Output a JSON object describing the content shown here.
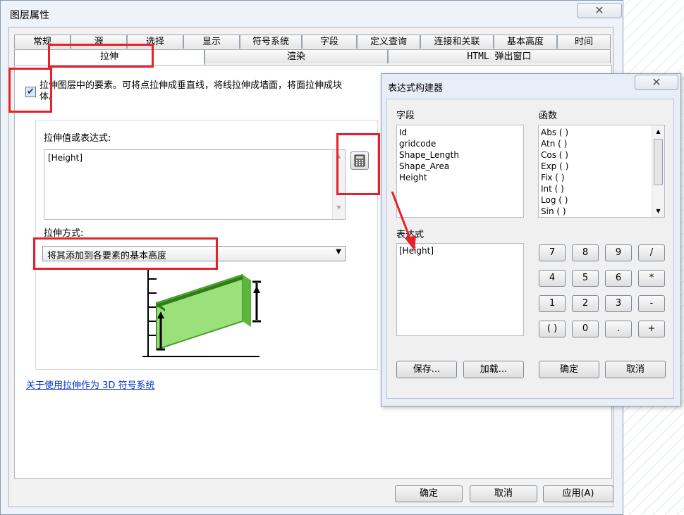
{
  "main": {
    "title": "图层属性",
    "close": "✕",
    "tabs_row1": [
      "常规",
      "源",
      "选择",
      "显示",
      "符号系统",
      "字段",
      "定义查询",
      "连接和关联",
      "基本高度",
      "时间"
    ],
    "tabs_row2": [
      "拉伸",
      "渲染",
      "HTML 弹出窗口"
    ],
    "active_tab": "拉伸",
    "extrude_checkbox_checked": true,
    "extrude_label": "拉伸图层中的要素。可将点拉伸成垂直线，将线拉伸成墙面，将面拉伸成块体。",
    "expr_label": "拉伸值或表达式:",
    "expr_value": "[Height]",
    "calc_icon": "calculator-icon",
    "method_label": "拉伸方式:",
    "method_value": "将其添加到各要素的基本高度",
    "link": "关于使用拉伸作为 3D 符号系统",
    "buttons": {
      "ok": "确定",
      "cancel": "取消",
      "apply": "应用(A)"
    }
  },
  "expression_builder": {
    "title": "表达式构建器",
    "close": "✕",
    "fields_label": "字段",
    "fields": [
      "Id",
      "gridcode",
      "Shape_Length",
      "Shape_Area",
      "Height"
    ],
    "functions_label": "函数",
    "functions": [
      "Abs ( )",
      "Atn ( )",
      "Cos ( )",
      "Exp ( )",
      "Fix ( )",
      "Int ( )",
      "Log ( )",
      "Sin ( )"
    ],
    "expression_label": "表达式",
    "expression_value": "[Height]",
    "keypad": [
      [
        "7",
        "8",
        "9",
        "/"
      ],
      [
        "4",
        "5",
        "6",
        "*"
      ],
      [
        "1",
        "2",
        "3",
        "-"
      ],
      [
        "( )",
        "0",
        ".",
        "+"
      ]
    ],
    "buttons": {
      "save": "保存...",
      "load": "加载...",
      "ok": "确定",
      "cancel": "取消"
    }
  },
  "colors": {
    "highlight": "#e8202a",
    "link": "#0033cc",
    "extrude_green": "#7fd65a"
  }
}
